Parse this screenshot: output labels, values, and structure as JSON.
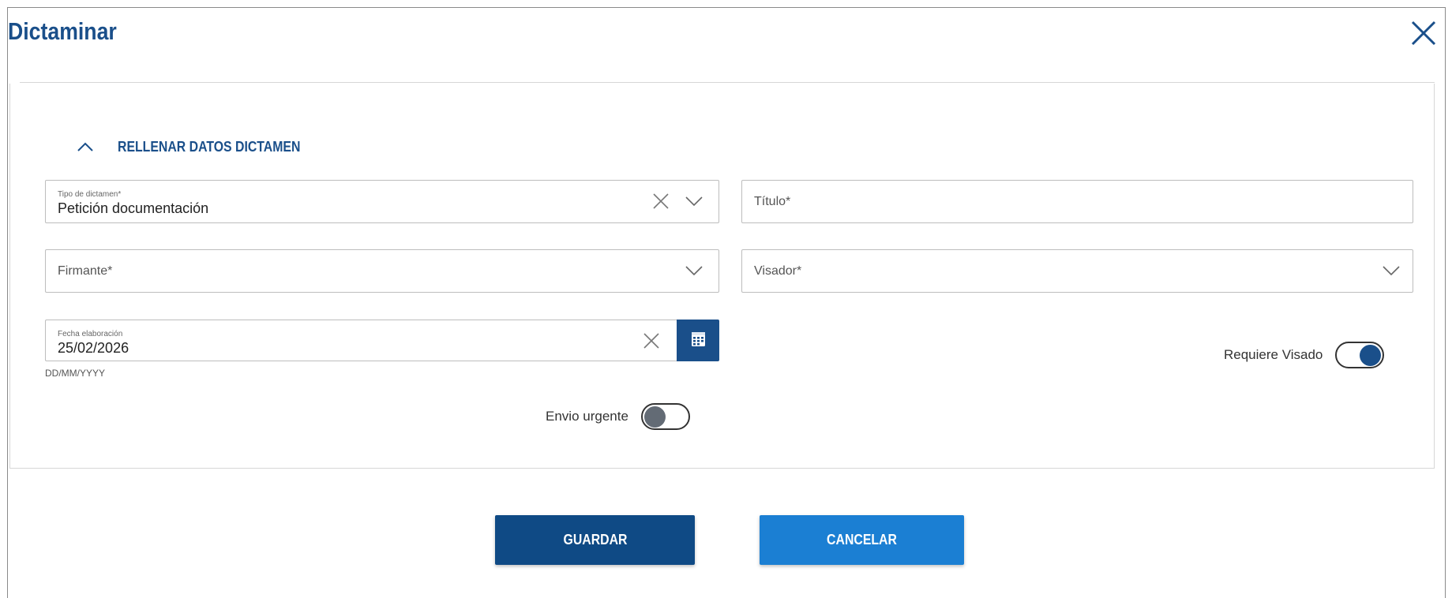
{
  "dialog": {
    "title": "Dictaminar",
    "close_icon": "close-icon"
  },
  "section": {
    "label": "RELLENAR DATOS DICTAMEN",
    "expanded": true,
    "toggle_icon": "chevron-up-icon"
  },
  "fields": {
    "tipo": {
      "label": "Tipo de dictamen*",
      "value": "Petición documentación"
    },
    "titulo": {
      "placeholder": "Título*",
      "value": ""
    },
    "firmante": {
      "placeholder": "Firmante*",
      "value": ""
    },
    "visador": {
      "placeholder": "Visador*",
      "value": ""
    },
    "fecha": {
      "label": "Fecha elaboración",
      "value": "25/02/2026",
      "hint": "DD/MM/YYYY"
    }
  },
  "toggles": {
    "requiere_visado": {
      "label": "Requiere Visado",
      "on": true
    },
    "envio_urgente": {
      "label": "Envio urgente",
      "on": false
    }
  },
  "buttons": {
    "save": "GUARDAR",
    "cancel": "CANCELAR"
  },
  "colors": {
    "brand": "#1a4f8a",
    "save_bg": "#0f4a85",
    "cancel_bg": "#1b7fd3",
    "toggle_off": "#636b75"
  }
}
